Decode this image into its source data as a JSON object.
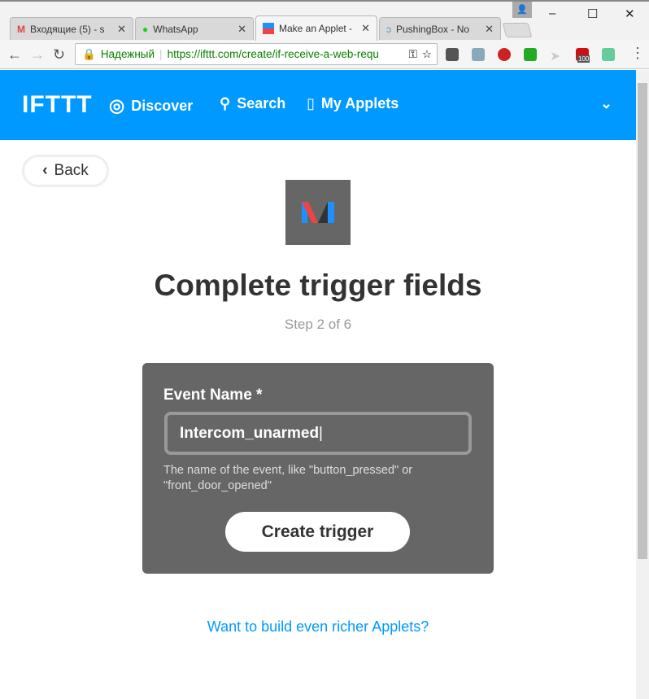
{
  "browser": {
    "tabs": [
      {
        "title": "Входящие (5) - s",
        "icon": "gmail-icon"
      },
      {
        "title": "WhatsApp",
        "icon": "whatsapp-icon"
      },
      {
        "title": "Make an Applet -",
        "icon": "ifttt-maker-icon",
        "active": true
      },
      {
        "title": "PushingBox - No",
        "icon": "pushingbox-icon"
      }
    ],
    "secure_label": "Надежный",
    "url": "https://ifttt.com/create/if-receive-a-web-requ",
    "abp_badge": "100"
  },
  "header": {
    "logo": "IFTTT",
    "nav": [
      {
        "label": "Discover",
        "icon": "eye-icon"
      },
      {
        "label": "Search",
        "icon": "search-icon"
      },
      {
        "label": "My Applets",
        "icon": "document-icon"
      }
    ],
    "color": "#0099ff"
  },
  "main": {
    "back_label": "Back",
    "title": "Complete trigger fields",
    "step": "Step 2 of 6",
    "form": {
      "field_label": "Event Name *",
      "field_value": "Intercom_unarmed",
      "help": "The name of the event, like \"button_pressed\" or \"front_door_opened\"",
      "submit_label": "Create trigger"
    },
    "footer_link": "Want to build even richer Applets?"
  }
}
